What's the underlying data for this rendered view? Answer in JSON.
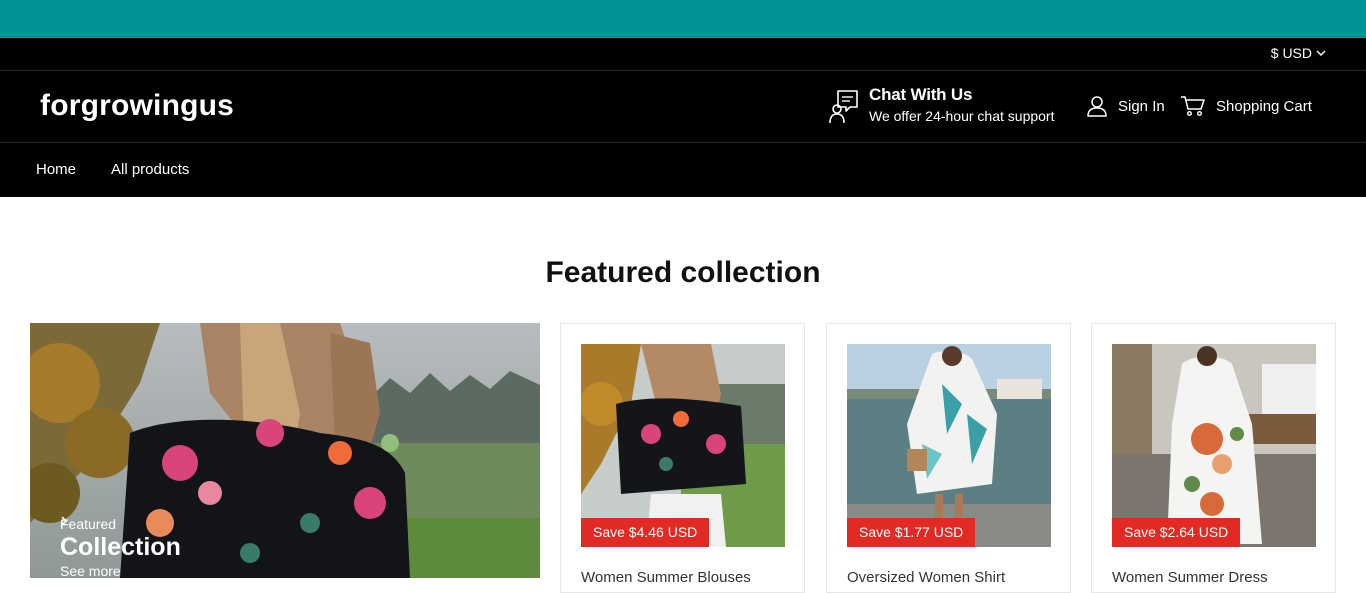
{
  "topbar": {
    "currency": "$ USD"
  },
  "header": {
    "logo": "forgrowingus",
    "chat_title": "Chat With Us",
    "chat_subtitle": "We offer 24-hour chat support",
    "signin_label": "Sign In",
    "cart_label": "Shopping Cart"
  },
  "nav": {
    "items": [
      {
        "label": "Home"
      },
      {
        "label": "All products"
      }
    ]
  },
  "featured": {
    "title": "Featured collection",
    "hero": {
      "eyebrow": "Featured",
      "title": "Collection",
      "link": "See more"
    },
    "products": [
      {
        "badge": "Save $4.46 USD",
        "title": "Women Summer Blouses"
      },
      {
        "badge": "Save $1.77 USD",
        "title": "Oversized Women Shirt"
      },
      {
        "badge": "Save $2.64 USD",
        "title": "Women Summer Dress"
      }
    ]
  },
  "colors": {
    "announce": "#009394",
    "header": "#000000",
    "sale_badge": "#e02a23"
  }
}
